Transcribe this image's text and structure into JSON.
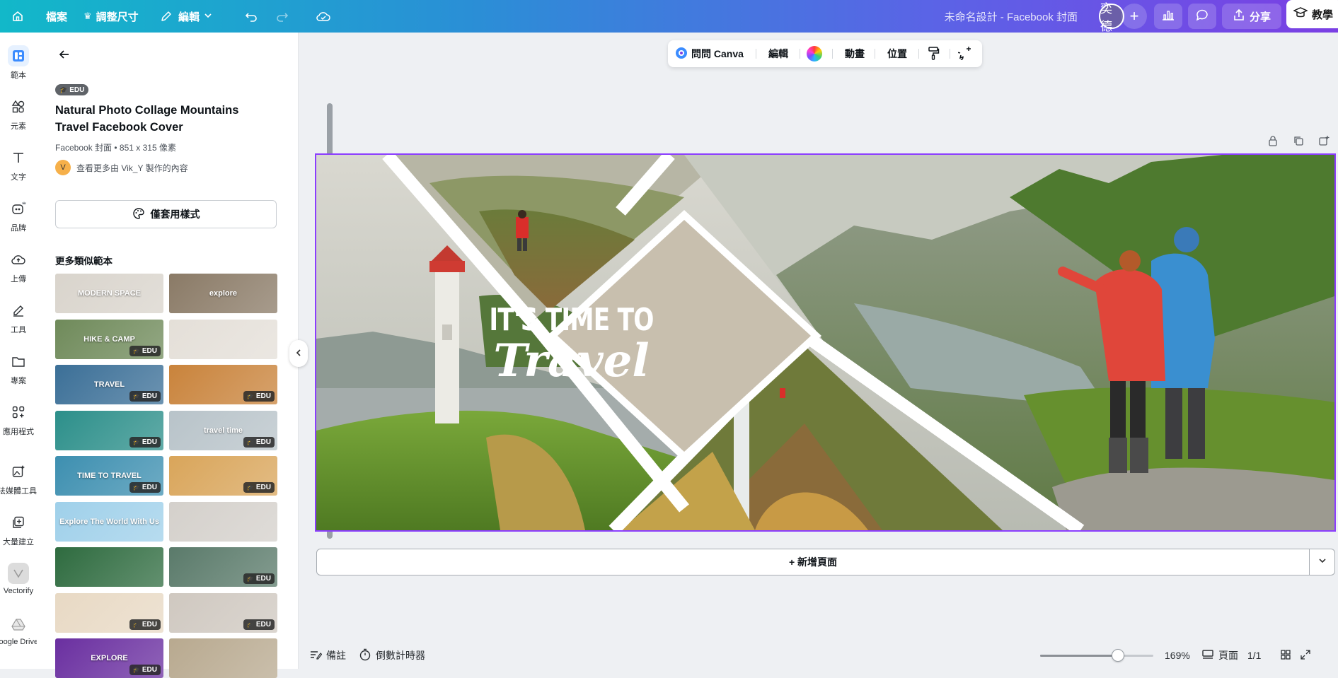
{
  "topbar": {
    "home_icon": "home-icon",
    "file_label": "檔案",
    "resize_label": "調整尺寸",
    "edit_label": "編輯",
    "undo_icon": "undo-icon",
    "redo_icon": "redo-icon",
    "cloud_icon": "cloud-check-icon",
    "design_title": "未命名設計 - Facebook 封面",
    "avatar_text": "奕德",
    "add_icon": "+",
    "share_label": "分享",
    "teach_label": "教學"
  },
  "rail": {
    "items": [
      {
        "label": "範本",
        "icon": "templates-icon"
      },
      {
        "label": "元素",
        "icon": "elements-icon"
      },
      {
        "label": "文字",
        "icon": "text-icon"
      },
      {
        "label": "品牌",
        "icon": "brand-icon"
      },
      {
        "label": "上傳",
        "icon": "upload-icon"
      },
      {
        "label": "工具",
        "icon": "draw-icon"
      },
      {
        "label": "專案",
        "icon": "folder-icon"
      },
      {
        "label": "應用程式",
        "icon": "apps-icon"
      },
      {
        "label": "魔法媒體工具",
        "icon": "magic-media-icon"
      },
      {
        "label": "大量建立",
        "icon": "bulk-create-icon"
      },
      {
        "label": "Vectorify",
        "icon": "vectorify-icon"
      },
      {
        "label": "Google Drive",
        "icon": "google-drive-icon"
      }
    ]
  },
  "panel": {
    "edu_badge": "EDU",
    "title": "Natural Photo Collage Mountains Travel Facebook Cover",
    "meta": "Facebook 封面 • 851 x 315 像素",
    "author_initial": "V",
    "author_text": "查看更多由 Vik_Y 製作的內容",
    "apply_label": "僅套用樣式",
    "more_heading": "更多類似範本",
    "thumbnails": [
      {
        "text": "MODERN SPACE",
        "edu": false,
        "bg": "#d9d4cc"
      },
      {
        "text": "explore",
        "edu": false,
        "bg": "#8a7a66"
      },
      {
        "text": "HIKE & CAMP",
        "edu": true,
        "bg": "#6f8a5a"
      },
      {
        "text": "",
        "edu": false,
        "bg": "#e4dfd8"
      },
      {
        "text": "TRAVEL",
        "edu": true,
        "bg": "#3b6f97"
      },
      {
        "text": "",
        "edu": true,
        "bg": "#c9833b"
      },
      {
        "text": "",
        "edu": true,
        "bg": "#2c8f8a"
      },
      {
        "text": "travel time",
        "edu": true,
        "bg": "#b8c3c9"
      },
      {
        "text": "TIME TO TRAVEL",
        "edu": true,
        "bg": "#3d8fb0"
      },
      {
        "text": "",
        "edu": true,
        "bg": "#d9a55a"
      },
      {
        "text": "Explore The World With Us",
        "edu": false,
        "bg": "#9fd0ea"
      },
      {
        "text": "",
        "edu": false,
        "bg": "#d4d0cb"
      },
      {
        "text": "",
        "edu": false,
        "bg": "#2e6b3f"
      },
      {
        "text": "",
        "edu": true,
        "bg": "#5a7a6a"
      },
      {
        "text": "",
        "edu": true,
        "bg": "#e8d9c4"
      },
      {
        "text": "",
        "edu": true,
        "bg": "#cfc8c0"
      },
      {
        "text": "EXPLORE",
        "edu": true,
        "bg": "#6a2fa0"
      },
      {
        "text": "",
        "edu": false,
        "bg": "#b8a98f"
      }
    ],
    "edu_tag": "EDU"
  },
  "floating_toolbar": {
    "ask_label": "問問 Canva",
    "edit_label": "編輯",
    "animate_label": "動畫",
    "position_label": "位置"
  },
  "canvas": {
    "line1": "IT'S TIME TO",
    "line2": "Travel",
    "accent": "#8b3dff",
    "diamond_color": "#c8bfae"
  },
  "add_page_label": "+ 新增頁面",
  "bottombar": {
    "notes_label": "備註",
    "timer_label": "倒數計時器",
    "zoom_value": 0.69,
    "zoom_label": "169%",
    "pages_label": "頁面",
    "page_count": "1/1"
  }
}
